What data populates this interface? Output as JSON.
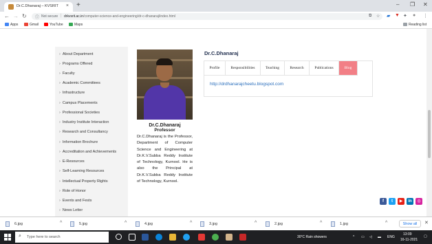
{
  "browser": {
    "tab_title": "Dr.C.Dhanaraj – KVSRIT",
    "new_tab": "+",
    "close_tab": "×",
    "window": {
      "minimize": "–",
      "restore": "❐",
      "close": "✕"
    },
    "security_label": "Not secure",
    "url_domain": "drkvsrit.ac.in",
    "url_path": "/computer-science-and-engineering/dr-c-dhanaraj/index.html",
    "bookmarks": [
      {
        "label": "Apps",
        "color": "#4285f4"
      },
      {
        "label": "Gmail",
        "color": "#ea4335"
      },
      {
        "label": "YouTube",
        "color": "#ff0000"
      },
      {
        "label": "Maps",
        "color": "#34a853"
      }
    ],
    "reading_list": "Reading list"
  },
  "sidebar": {
    "items": [
      {
        "label": "About Department"
      },
      {
        "label": "Programs Offered"
      },
      {
        "label": "Faculty"
      },
      {
        "label": "Academic Committees"
      },
      {
        "label": "Infrastructure"
      },
      {
        "label": "Campus Placements"
      },
      {
        "label": "Professional Societies"
      },
      {
        "label": "Industry Institute Interaction"
      },
      {
        "label": "Research and Consultancy"
      },
      {
        "label": "Information Brochure"
      },
      {
        "label": "Accreditation and Achievements"
      },
      {
        "label": "E-Resources"
      },
      {
        "label": "Self-Learning Resources"
      },
      {
        "label": "Intellectual Property Rights"
      },
      {
        "label": "Role of Honor"
      },
      {
        "label": "Events and Fests"
      },
      {
        "label": "News Letter"
      }
    ]
  },
  "profile": {
    "name": "Dr.C.Dhanaraj",
    "title": "Professor",
    "bio": "Dr.C.Dhanaraj is the Professor, Department of Computer Science and Engineering at Dr.K.V.Subba Reddy Institute of Technology, Kurnool. He is also the Principal at Dr.K.V.Subba Reddy Institute of Technology, Kurnool."
  },
  "main": {
    "heading": "Dr.C.Dhanaraj",
    "tabs": [
      {
        "label": "Profile"
      },
      {
        "label": "Responsibilities"
      },
      {
        "label": "Teaching"
      },
      {
        "label": "Research"
      },
      {
        "label": "Publications"
      },
      {
        "label": "Blog"
      }
    ],
    "active_tab": "Blog",
    "blog_link": "http://drdhanarajcheetu.blogspot.com"
  },
  "social": [
    {
      "icon": "facebook-icon",
      "glyph": "f",
      "color": "#3b5998"
    },
    {
      "icon": "twitter-icon",
      "glyph": "t",
      "color": "#1da1f2"
    },
    {
      "icon": "youtube-icon",
      "glyph": "▶",
      "color": "#e62117"
    },
    {
      "icon": "linkedin-icon",
      "glyph": "in",
      "color": "#0077b5"
    },
    {
      "icon": "instagram-icon",
      "glyph": "◎",
      "color": "#d6249f"
    }
  ],
  "downloads": {
    "items": [
      {
        "name": "6.jpg"
      },
      {
        "name": "5.jpg"
      },
      {
        "name": "4.jpg"
      },
      {
        "name": "3.jpg"
      },
      {
        "name": "2.jpg"
      },
      {
        "name": "1.jpg"
      }
    ],
    "show_all": "Show all",
    "close": "✕"
  },
  "taskbar": {
    "search_placeholder": "Type here to search",
    "weather": "30°C  Rain showers",
    "language": "ENG",
    "time": "13:09",
    "date": "16-11-2021"
  }
}
